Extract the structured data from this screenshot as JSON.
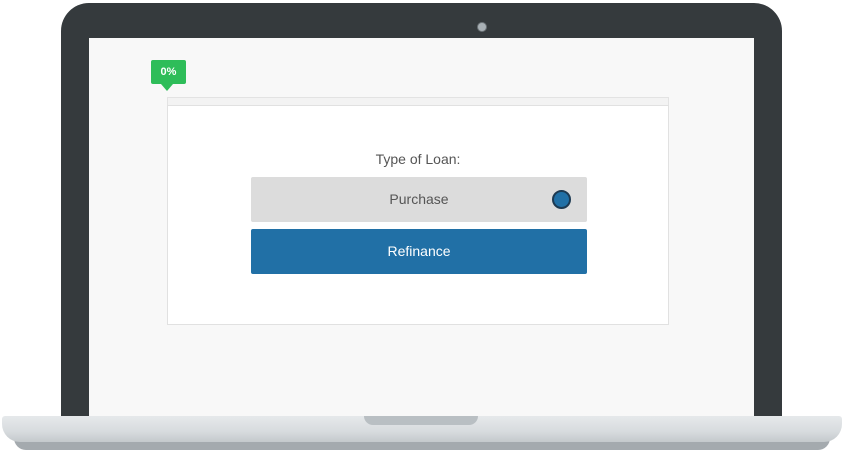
{
  "progress": {
    "label": "0%",
    "value": 0
  },
  "form": {
    "question": "Type of Loan:",
    "options": [
      {
        "label": "Purchase",
        "selected": false,
        "indicator_icon": "radio-dot-icon"
      },
      {
        "label": "Refinance",
        "selected": false
      }
    ]
  },
  "colors": {
    "accent": "#2170a6",
    "progress": "#2ebd59",
    "bezel": "#353a3d",
    "option_bg": "#dcdcdc"
  }
}
